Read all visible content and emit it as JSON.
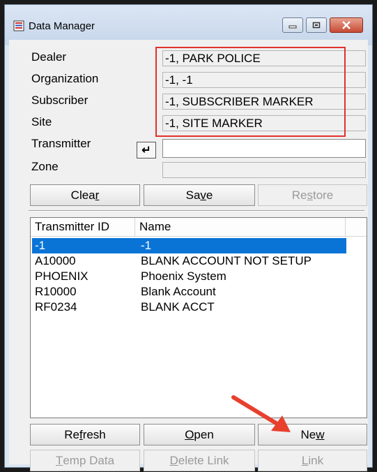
{
  "window": {
    "title": "Data Manager"
  },
  "fields": {
    "dealer": {
      "label": "Dealer",
      "value": "-1, PARK POLICE"
    },
    "organization": {
      "label": "Organization",
      "value": "-1, -1"
    },
    "subscriber": {
      "label": "Subscriber",
      "value": "-1, SUBSCRIBER MARKER"
    },
    "site": {
      "label": "Site",
      "value": "-1, SITE MARKER"
    },
    "transmitter": {
      "label": "Transmitter",
      "value": "",
      "enter_glyph": "↵"
    },
    "zone": {
      "label": "Zone",
      "value": ""
    }
  },
  "buttons": {
    "clear": {
      "pre": "Clea",
      "key": "r",
      "post": ""
    },
    "save": {
      "pre": "Sa",
      "key": "v",
      "post": "e"
    },
    "restore": {
      "pre": "Re",
      "key": "s",
      "post": "tore"
    },
    "refresh": {
      "pre": "Re",
      "key": "f",
      "post": "resh"
    },
    "open": {
      "pre": "",
      "key": "O",
      "post": "pen"
    },
    "new": {
      "pre": "Ne",
      "key": "w",
      "post": ""
    },
    "temp_data": {
      "pre": "",
      "key": "T",
      "post": "emp Data"
    },
    "delete_link": {
      "pre": "",
      "key": "D",
      "post": "elete Link"
    },
    "link": {
      "pre": "",
      "key": "L",
      "post": "ink"
    }
  },
  "list": {
    "columns": [
      "Transmitter ID",
      "Name"
    ],
    "rows": [
      {
        "id": "-1",
        "name": "-1",
        "selected": true
      },
      {
        "id": "A10000",
        "name": "BLANK ACCOUNT NOT SETUP",
        "selected": false
      },
      {
        "id": "PHOENIX",
        "name": "Phoenix System",
        "selected": false
      },
      {
        "id": "R10000",
        "name": "Blank Account",
        "selected": false
      },
      {
        "id": "RF0234",
        "name": "BLANK ACCT",
        "selected": false
      }
    ]
  },
  "colors": {
    "highlight": "#e0312b",
    "selection": "#0a74d6",
    "arrow": "#e8402e"
  },
  "icons": [
    "app-icon",
    "minimize-icon",
    "maximize-icon",
    "close-icon",
    "enter-icon",
    "red-arrow-annotation"
  ]
}
